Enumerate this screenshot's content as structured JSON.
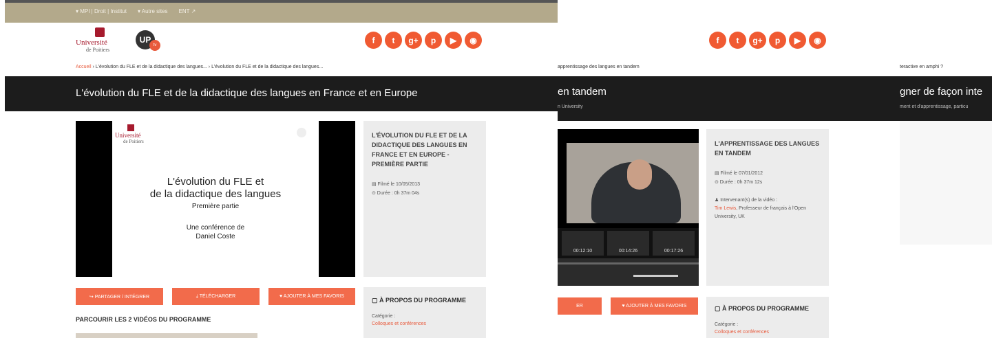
{
  "top_links": [
    "▾ MPI | Droit | Institut",
    "▾ Autre sites",
    "ENT ↗"
  ],
  "logos": {
    "univ_name": "Université",
    "univ_sub": "de Poitiers",
    "up": "UP",
    "up_badge": "tv"
  },
  "social_icons": [
    {
      "name": "facebook",
      "glyph": "f"
    },
    {
      "name": "twitter",
      "glyph": "t"
    },
    {
      "name": "google-plus",
      "glyph": "g+"
    },
    {
      "name": "pinterest",
      "glyph": "p"
    },
    {
      "name": "youtube",
      "glyph": "▶"
    },
    {
      "name": "rss",
      "glyph": "◉"
    }
  ],
  "panel1": {
    "breadcrumb_home": "Accueil",
    "breadcrumb_rest": " › L'évolution du FLE et de la didactique des langues... › L'évolution du FLE et de la didactique des langues...",
    "title": "L'évolution du FLE et de la didactique des langues en France et en Europe",
    "slide": {
      "brand": "Université",
      "brand_sub": "de Poitiers",
      "line1": "L'évolution du FLE et",
      "line2": "de la didactique des langues",
      "line3": "Première partie",
      "line4": "Une conférence de",
      "line5": "Daniel Coste"
    },
    "info": {
      "title": "L'évolution du FLE et de la didactique des langues en France et en Europe - Première partie",
      "filmed": "▤ Filmé le 10/05/2013",
      "duration": "⊙ Durée : 0h 37m 04s"
    },
    "buttons": {
      "share": "↪ PARTAGER / INTÉGRER",
      "download": "⤓ TÉLÉCHARGER",
      "favorite": "♥ AJOUTER À MES FAVORIS"
    },
    "browse_heading": "PARCOURIR LES 2 VIDÉOS DU PROGRAMME",
    "about": {
      "heading": "▢ À PROPOS DU PROGRAMME",
      "category_label": "Catégorie :",
      "category_value": "Colloques et conférences"
    }
  },
  "panel2": {
    "breadcrumb": "apprentissage des langues en tandem",
    "title": "en tandem",
    "subtitle": "n University",
    "timestamps": [
      "00:12:10",
      "00:14:26",
      "00:17:26"
    ],
    "info": {
      "title": "L'apprentissage des langues en tandem",
      "filmed": "▤ Filmé le 07/01/2012",
      "duration": "⊙ Durée : 0h 37m 12s",
      "speaker_label": "♟ Intervenant(s) de la vidéo :",
      "speaker_name": "Tim Lewis",
      "speaker_desc": ", Professeur de français à l'Open University, UK"
    },
    "buttons": {
      "share_partial": "ER",
      "favorite": "♥ AJOUTER À MES FAVORIS"
    },
    "about": {
      "heading": "▢ À PROPOS DU PROGRAMME",
      "category_label": "Catégorie :",
      "category_value": "Colloques et conférences"
    }
  },
  "panel3": {
    "breadcrumb": "teractive en amphi ?",
    "title": "gner de façon inte",
    "subtitle": "ment et d'apprentissage, particu"
  }
}
